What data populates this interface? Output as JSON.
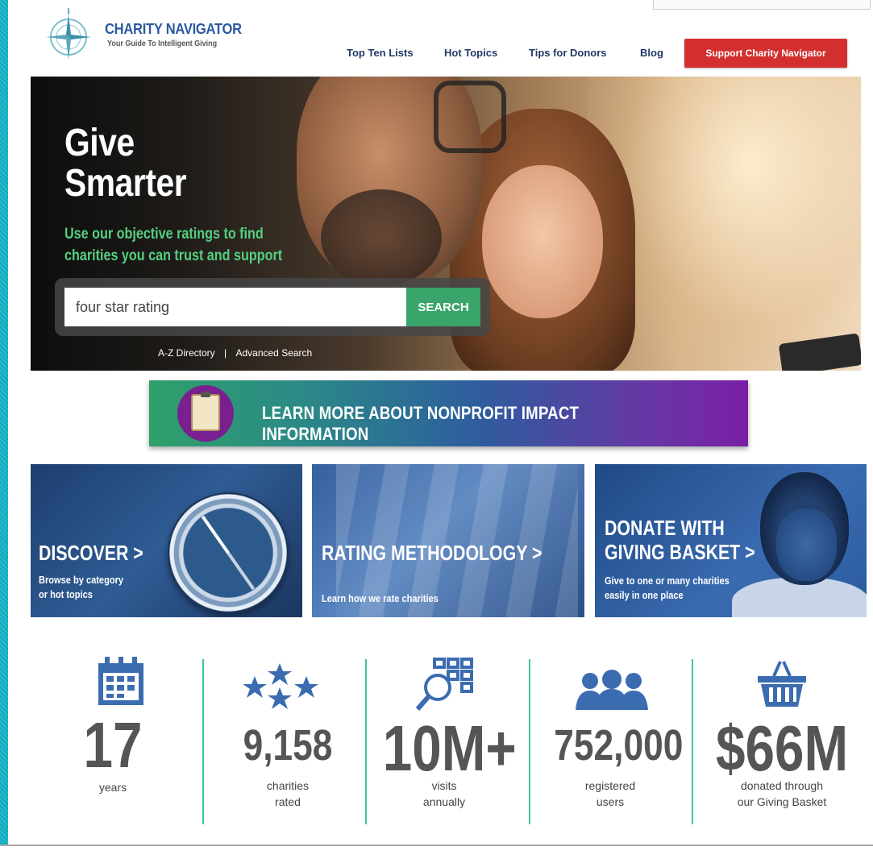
{
  "brand": {
    "name": "CHARITY NAVIGATOR",
    "tagline": "Your Guide To Intelligent Giving"
  },
  "nav": {
    "items": [
      {
        "label": "Top Ten Lists"
      },
      {
        "label": "Hot Topics"
      },
      {
        "label": "Tips for Donors"
      },
      {
        "label": "Blog"
      }
    ],
    "support_label": "Support Charity Navigator"
  },
  "hero": {
    "title_line1": "Give",
    "title_line2": "Smarter",
    "subtitle_line1": "Use our objective ratings to find",
    "subtitle_line2": "charities you can trust and support",
    "search_value": "four star rating",
    "search_button": "SEARCH",
    "link_az": "A-Z Directory",
    "link_sep": "|",
    "link_advanced": "Advanced Search"
  },
  "impact_banner": {
    "label": "LEARN MORE ABOUT NONPROFIT IMPACT INFORMATION"
  },
  "tiles": {
    "discover": {
      "title": "DISCOVER >",
      "sub_line1": "Browse by category",
      "sub_line2": "or hot topics"
    },
    "methodology": {
      "title": "RATING METHODOLOGY >",
      "sub": "Learn how we rate charities"
    },
    "donate": {
      "title_line1": "DONATE WITH",
      "title_line2": "GIVING BASKET >",
      "sub_line1": "Give to one or many charities",
      "sub_line2": "easily in one place"
    }
  },
  "stats": [
    {
      "icon": "calendar-icon",
      "value": "17",
      "label_line1": "years",
      "label_line2": ""
    },
    {
      "icon": "stars-icon",
      "value": "9,158",
      "label_line1": "charities",
      "label_line2": "rated"
    },
    {
      "icon": "search-grid-icon",
      "value": "10M+",
      "label_line1": "visits",
      "label_line2": "annually"
    },
    {
      "icon": "users-icon",
      "value": "752,000",
      "label_line1": "registered",
      "label_line2": "users"
    },
    {
      "icon": "basket-icon",
      "value": "$66M",
      "label_line1": "donated through",
      "label_line2": "our Giving Basket"
    }
  ],
  "colors": {
    "brand_blue": "#2b5aa0",
    "nav_text": "#233a66",
    "support_red": "#d32f2f",
    "hero_green": "#55d080",
    "search_green": "#3aa56a",
    "divider_teal": "#3ec4a3",
    "icon_blue": "#3b6cb0"
  }
}
